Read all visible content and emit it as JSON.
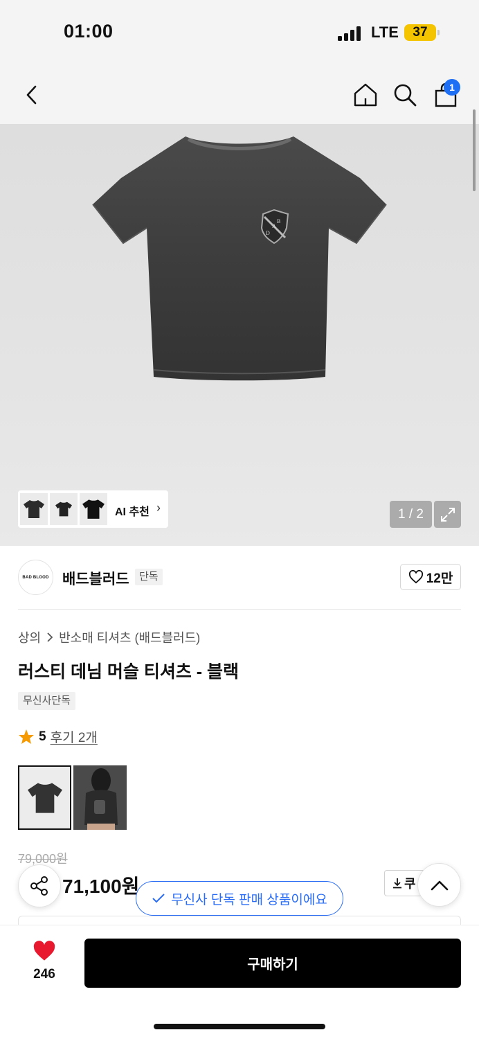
{
  "status_bar": {
    "time": "01:00",
    "network": "LTE",
    "battery": "37"
  },
  "nav": {
    "cart_count": "1"
  },
  "hero": {
    "emblem_letters": [
      "B",
      "A",
      "D"
    ],
    "ai_label": "AI 추천",
    "page_indicator": "1 / 2"
  },
  "brand": {
    "logo_text": "BAD BLOOD",
    "name": "배드블러드",
    "tag": "단독",
    "likes": "12만"
  },
  "product": {
    "breadcrumb": [
      "상의",
      "반소매 티셔츠 (배드블러드)"
    ],
    "title": "러스티 데님 머슬 티셔츠 - 블랙",
    "exclusive_tag": "무신사단독",
    "rating": "5",
    "review_link": "후기 2개",
    "original_price": "79,000원",
    "sale_price": "71,100원",
    "coupon_label": "쿠"
  },
  "toast": {
    "text": "무신사 단독 판매 상품이에요"
  },
  "bottom": {
    "heart_count": "246",
    "buy_label": "구매하기"
  },
  "colors": {
    "accent_blue": "#2a6df4",
    "heart_red": "#e8182e",
    "star_orange": "#f59a00",
    "battery_yellow": "#f5c400"
  }
}
